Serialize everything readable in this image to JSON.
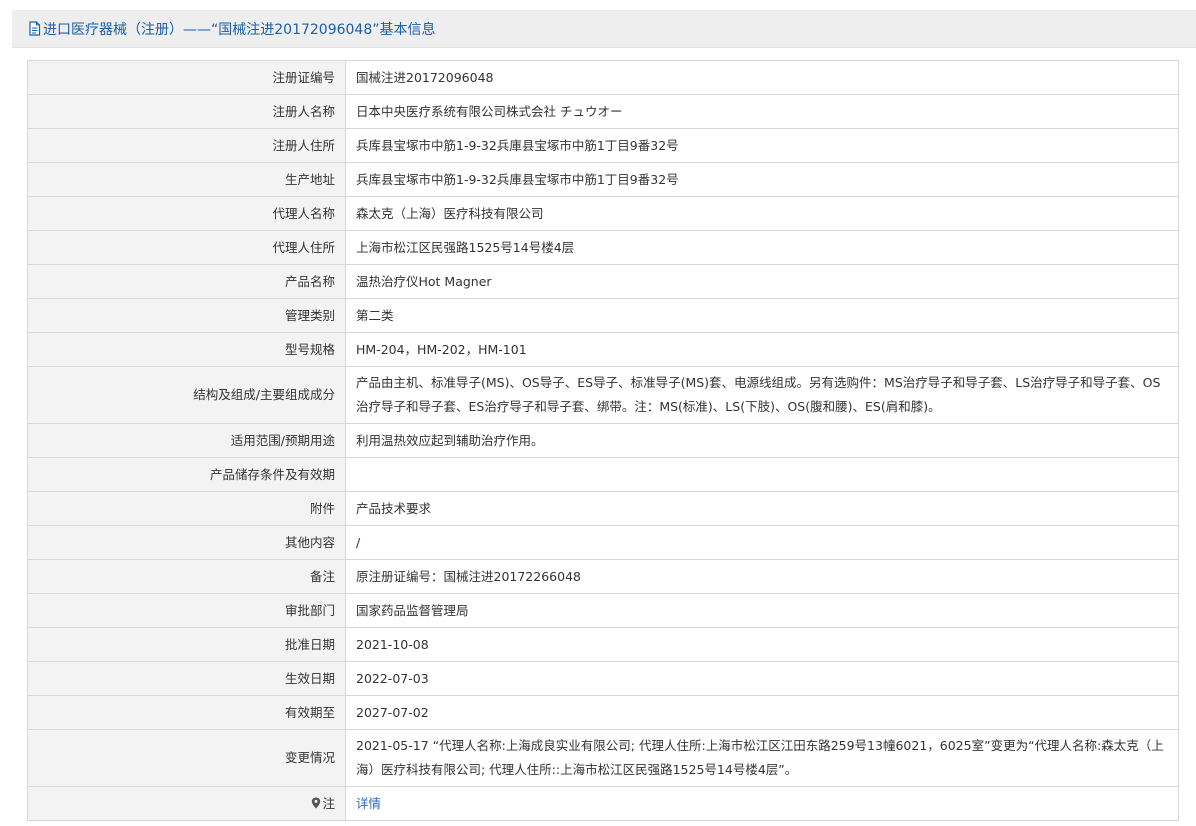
{
  "header": {
    "title": "进口医疗器械（注册）——“国械注进20172096048”基本信息",
    "icon": "document-icon",
    "accent_color": "#1a5fa8"
  },
  "rows": [
    {
      "label": "注册证编号",
      "value": "国械注进20172096048"
    },
    {
      "label": "注册人名称",
      "value": "日本中央医疗系统有限公司株式会社 チュウオー"
    },
    {
      "label": "注册人住所",
      "value": "兵库县宝塚市中筋1-9-32兵庫县宝塚市中筋1丁目9番32号"
    },
    {
      "label": "生产地址",
      "value": "兵库县宝塚市中筋1-9-32兵庫县宝塚市中筋1丁目9番32号"
    },
    {
      "label": "代理人名称",
      "value": "森太克（上海）医疗科技有限公司"
    },
    {
      "label": "代理人住所",
      "value": "上海市松江区民强路1525号14号楼4层"
    },
    {
      "label": "产品名称",
      "value": "温热治疗仪Hot Magner"
    },
    {
      "label": "管理类别",
      "value": "第二类"
    },
    {
      "label": "型号规格",
      "value": "HM-204，HM-202，HM-101"
    },
    {
      "label": "结构及组成/主要组成成分",
      "value": "产品由主机、标准导子(MS)、OS导子、ES导子、标准导子(MS)套、电源线组成。另有选购件：MS治疗导子和导子套、LS治疗导子和导子套、OS治疗导子和导子套、ES治疗导子和导子套、绑带。注：MS(标准)、LS(下肢)、OS(腹和腰)、ES(肩和膝)。"
    },
    {
      "label": "适用范围/预期用途",
      "value": "利用温热效应起到辅助治疗作用。"
    },
    {
      "label": "产品储存条件及有效期",
      "value": ""
    },
    {
      "label": "附件",
      "value": "产品技术要求"
    },
    {
      "label": "其他内容",
      "value": "/"
    },
    {
      "label": "备注",
      "value": "原注册证编号：国械注进20172266048"
    },
    {
      "label": "审批部门",
      "value": "国家药品监督管理局"
    },
    {
      "label": "批准日期",
      "value": "2021-10-08"
    },
    {
      "label": "生效日期",
      "value": "2022-07-03"
    },
    {
      "label": "有效期至",
      "value": "2027-07-02"
    },
    {
      "label": "变更情况",
      "value": "2021-05-17 “代理人名称:上海成良实业有限公司; 代理人住所:上海市松江区江田东路259号13幢6021，6025室”变更为“代理人名称:森太克（上海）医疗科技有限公司; 代理人住所::上海市松江区民强路1525号14号楼4层”。"
    }
  ],
  "note": {
    "label": "注",
    "icon": "map-pin-icon",
    "link_text": "详情",
    "link_color": "#2a6cbf"
  }
}
